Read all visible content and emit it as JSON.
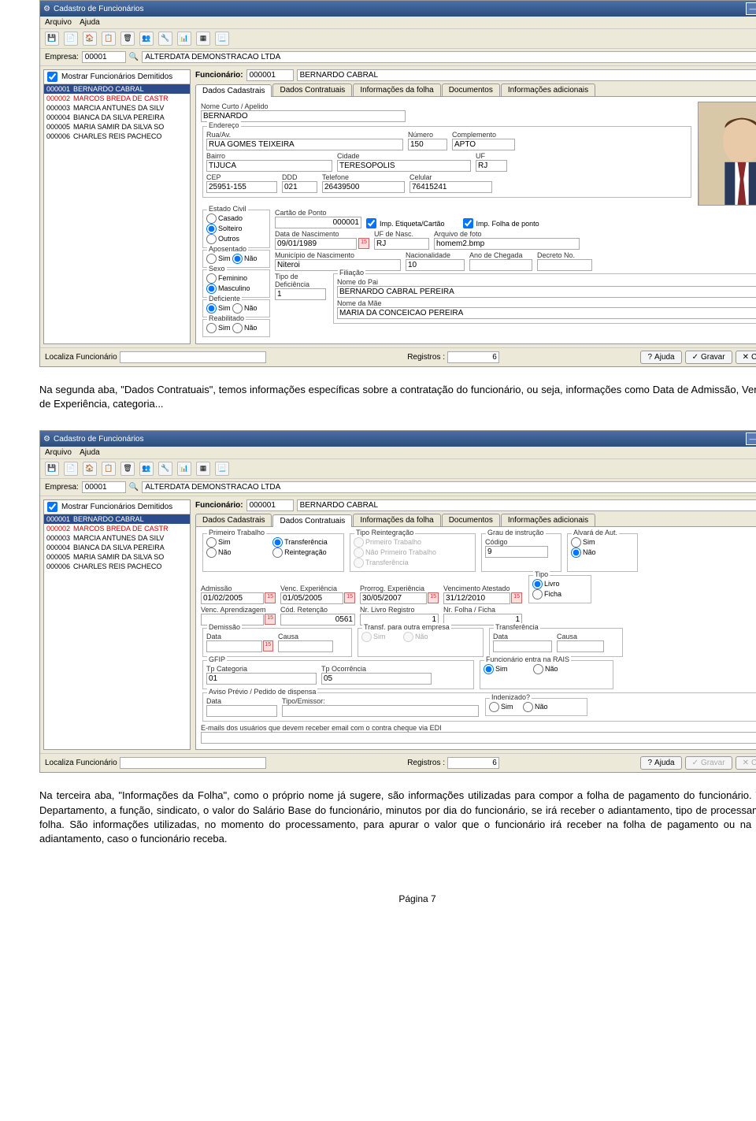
{
  "win_title": "Cadastro de Funcionários",
  "menu": {
    "file": "Arquivo",
    "help": "Ajuda"
  },
  "emp": {
    "label": "Empresa:",
    "code": "00001",
    "name": "ALTERDATA DEMONSTRACAO LTDA"
  },
  "show_fired": "Mostrar Funcionários Demitidos",
  "employees": [
    {
      "code": "000001",
      "name": "BERNARDO CABRAL",
      "sel": true
    },
    {
      "code": "000002",
      "name": "MARCOS BREDA DE CASTR",
      "red": true
    },
    {
      "code": "000003",
      "name": "MARCIA ANTUNES DA SILV"
    },
    {
      "code": "000004",
      "name": "BIANCA DA SILVA PEREIRA"
    },
    {
      "code": "000005",
      "name": "MARIA SAMIR DA SILVA SO"
    },
    {
      "code": "000006",
      "name": "CHARLES REIS PACHECO"
    }
  ],
  "func": {
    "label": "Funcionário:",
    "code": "000001",
    "name": "BERNARDO CABRAL"
  },
  "tabs": [
    "Dados Cadastrais",
    "Dados Contratuais",
    "Informações da folha",
    "Documentos",
    "Informações adicionais"
  ],
  "cad": {
    "nome_curto_lbl": "Nome Curto / Apelido",
    "nome_curto": "BERNARDO",
    "endereco_lbl": "Endereço",
    "rua_lbl": "Rua/Av.",
    "rua": "RUA GOMES TEIXEIRA",
    "numero_lbl": "Número",
    "numero": "150",
    "compl_lbl": "Complemento",
    "compl": "APTO",
    "bairro_lbl": "Bairro",
    "bairro": "TIJUCA",
    "cidade_lbl": "Cidade",
    "cidade": "TERESOPOLIS",
    "uf_lbl": "UF",
    "uf": "RJ",
    "cep_lbl": "CEP",
    "cep": "25951-155",
    "ddd_lbl": "DDD",
    "ddd": "021",
    "tel_lbl": "Telefone",
    "tel": "26439500",
    "cel_lbl": "Celular",
    "cel": "76415241",
    "est_civil_lbl": "Estado Civil",
    "casado": "Casado",
    "solteiro": "Solteiro",
    "outros": "Outros",
    "aposentado_lbl": "Aposentado",
    "sim": "Sim",
    "nao": "Não",
    "sexo_lbl": "Sexo",
    "fem": "Feminino",
    "masc": "Masculino",
    "def_lbl": "Deficiente",
    "tipo_def_lbl": "Tipo de Deficiência",
    "tipo_def": "1",
    "reab_lbl": "Reabilitado",
    "cartao_lbl": "Cartão de Ponto",
    "cartao": "000001",
    "imp_etq": "Imp. Etiqueta/Cartão",
    "imp_folha": "Imp. Folha de ponto",
    "nasc_lbl": "Data de Nascimento",
    "nasc": "09/01/1989",
    "uf_nasc_lbl": "UF de Nasc.",
    "uf_nasc": "RJ",
    "foto_lbl": "Arquivo de foto",
    "foto": "homem2.bmp",
    "mun_nasc_lbl": "Município de Nascimento",
    "mun_nasc": "Niteroi",
    "nac_lbl": "Nacionalidade",
    "nac": "10",
    "ano_lbl": "Ano de Chegada",
    "dec_lbl": "Decreto No.",
    "fil_lbl": "Filiação",
    "pai_lbl": "Nome do Pai",
    "pai": "BERNARDO CABRAL PEREIRA",
    "mae_lbl": "Nome da Mãe",
    "mae": "MARIA DA CONCEICAO PEREIRA"
  },
  "contr": {
    "prim_lbl": "Primeiro Trabalho",
    "tipo_re_lbl": "Tipo Reintegração",
    "prim": "Primeiro Trabalho",
    "nprim": "Não Primeiro Trabalho",
    "transf": "Transferência",
    "reint": "Reintegração",
    "grau_lbl": "Grau de instrução",
    "cod_lbl": "Código",
    "grau_cod": "9",
    "alv_lbl": "Alvará de Aut.",
    "adm_lbl": "Admissão",
    "adm": "01/02/2005",
    "vexp_lbl": "Venc. Experiência",
    "vexp": "01/05/2005",
    "pexp_lbl": "Prorrog. Experiência",
    "pexp": "30/05/2007",
    "vat_lbl": "Vencimento Atestado",
    "vat": "31/12/2010",
    "tipo_lbl": "Tipo",
    "livro": "Livro",
    "ficha": "Ficha",
    "vapr_lbl": "Venc. Aprendizagem",
    "cret_lbl": "Cód. Retenção",
    "cret": "0561",
    "nlivro_lbl": "Nr. Livro Registro",
    "nlivro": "1",
    "nfolha_lbl": "Nr. Folha / Ficha",
    "nfolha": "1",
    "dem_lbl": "Demissão",
    "data_lbl": "Data",
    "causa_lbl": "Causa",
    "transf2_lbl": "Transf. para outra empresa",
    "transf3_lbl": "Transferência",
    "gfip_lbl": "GFIP",
    "tpcat_lbl": "Tp Categoria",
    "tpcat": "01",
    "tpoco_lbl": "Tp Ocorrência",
    "tpoco": "05",
    "rais_lbl": "Funcionário entra na RAIS",
    "aviso_lbl": "Aviso Prévio / Pedido de dispensa",
    "tipoe_lbl": "Tipo/Emissor:",
    "ind_lbl": "Indenizado?",
    "email_lbl": "E-mails dos usuários que devem receber email com o contra cheque via EDI"
  },
  "footer": {
    "loc": "Localiza Funcionário",
    "reg": "Registros :",
    "regn": "6",
    "ajuda": "Ajuda",
    "gravar": "Gravar",
    "cancelar": "Cancelar"
  },
  "para1": "Na segunda aba, \"Dados Contratuais\", temos informações específicas sobre a contratação do funcionário, ou seja, informações como Data de Admissão, Vencimento de Experiência, categoria...",
  "para2": "Na terceira aba, \"Informações da Folha\", como o próprio nome já sugere, são informações utilizadas para compor a folha de pagamento do funcionário. Temos o Departamento, a função, sindicato, o valor do Salário Base do funcionário, minutos por dia do funcionário, se irá receber o adiantamento, tipo de processamento da folha. São informações utilizadas, no momento do processamento, para apurar o valor que o funcionário irá receber na folha de pagamento ou na folha de adiantamento, caso o funcionário receba.",
  "page": "Página 7"
}
